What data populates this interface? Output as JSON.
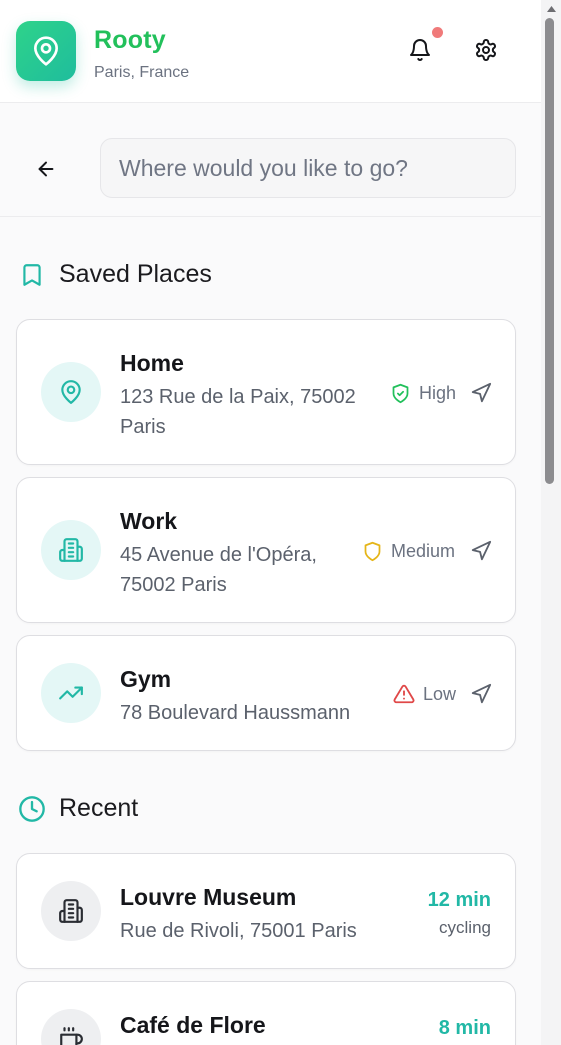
{
  "header": {
    "app_name": "Rooty",
    "location": "Paris, France",
    "icons": {
      "logo": "map-pin-icon",
      "notifications": "bell-icon",
      "settings": "gear-icon"
    },
    "has_unread_notifications": true
  },
  "search": {
    "placeholder": "Where would you like to go?",
    "value": ""
  },
  "saved_places": {
    "title": "Saved Places",
    "items": [
      {
        "name": "Home",
        "address": "123 Rue de la Paix, 75002 Paris",
        "icon": "map-pin-icon",
        "safety": "High",
        "safety_color": "#22c05b"
      },
      {
        "name": "Work",
        "address": "45 Avenue de l'Opéra, 75002 Paris",
        "icon": "building-icon",
        "safety": "Medium",
        "safety_color": "#e5b518"
      },
      {
        "name": "Gym",
        "address": "78 Boulevard Haussmann",
        "icon": "trending-up-icon",
        "safety": "Low",
        "safety_color": "#e04848"
      }
    ]
  },
  "recent": {
    "title": "Recent",
    "items": [
      {
        "name": "Louvre Museum",
        "address": "Rue de Rivoli, 75001 Paris",
        "icon": "building-icon",
        "duration": "12 min",
        "mode": "cycling"
      },
      {
        "name": "Café de Flore",
        "address": "",
        "icon": "coffee-icon",
        "duration": "8 min",
        "mode": ""
      }
    ]
  },
  "colors": {
    "brand": "#22c05b",
    "accent": "#1fbd9d",
    "notification_dot": "#f07a7a"
  }
}
